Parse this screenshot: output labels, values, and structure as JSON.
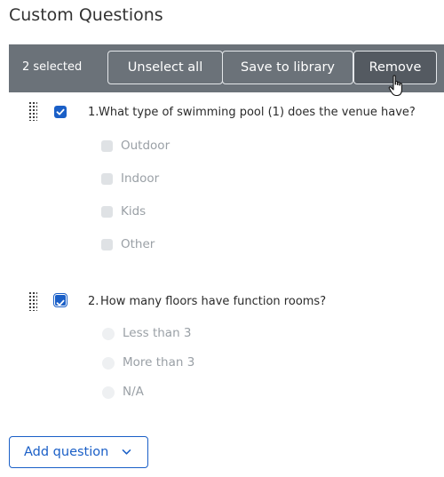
{
  "page": {
    "title": "Custom Questions"
  },
  "toolbar": {
    "selected_count": "2 selected",
    "unselect_all": "Unselect all",
    "save_to_library": "Save to library",
    "remove": "Remove"
  },
  "questions": [
    {
      "number": "1.",
      "text": "What type of swimming pool (1) does the venue have?",
      "selected": true,
      "kind": "checkbox",
      "options": [
        "Outdoor",
        "Indoor",
        "Kids",
        "Other"
      ]
    },
    {
      "number": "2.",
      "text": "How many floors have function rooms?",
      "selected": true,
      "kind": "radio",
      "options": [
        "Less than 3",
        "More than 3",
        "N/A"
      ]
    }
  ],
  "add_question": {
    "label": "Add question"
  },
  "icons": {
    "drag": "drag-handle-icon",
    "check": "checkmark-icon",
    "chevron": "chevron-down-icon",
    "cursor": "hand-pointer-icon"
  },
  "colors": {
    "accent": "#1a5fc7",
    "toolbar": "#6b7279",
    "remove_button": "#545a61",
    "option_text": "#9aa0a6"
  }
}
